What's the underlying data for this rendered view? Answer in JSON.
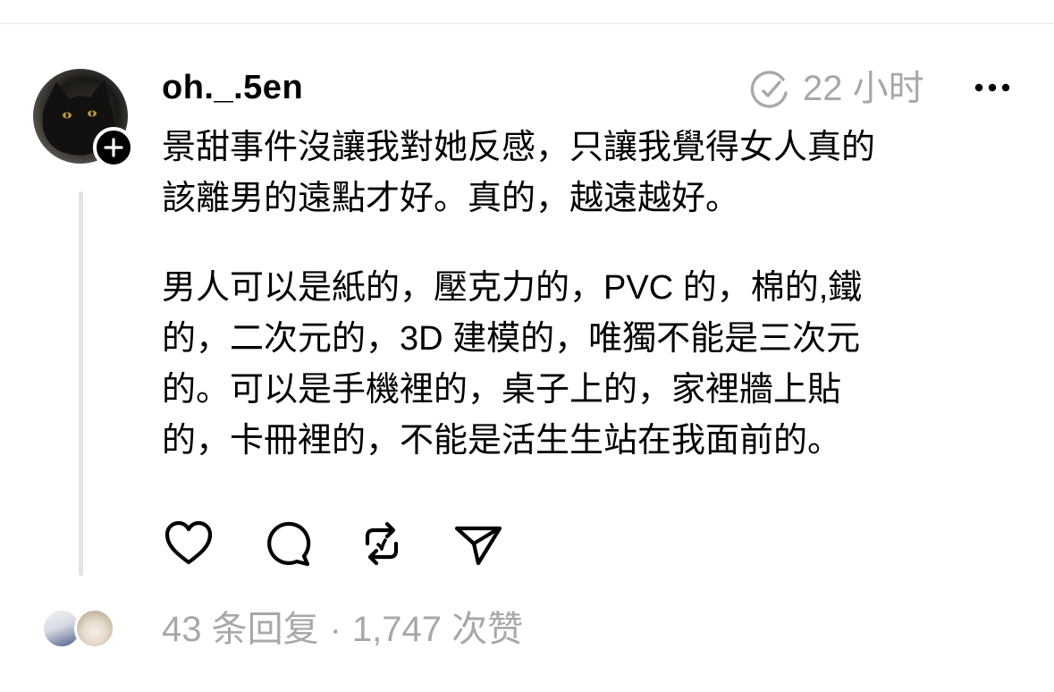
{
  "post": {
    "username": "oh._.5en",
    "time": "22 小时",
    "paragraphs": [
      "景甜事件沒讓我對她反感，只讓我覺得女人真的該離男的遠點才好。真的，越遠越好。",
      "男人可以是紙的，壓克力的，PVC 的，棉的,鐵的，二次元的，3D 建模的，唯獨不能是三次元的。可以是手機裡的，桌子上的，家裡牆上貼的，卡冊裡的，不能是活生生站在我面前的。"
    ],
    "lines_p1": [
      "景甜事件沒讓我對她反感，只讓我覺得女人真的",
      "該離男的遠點才好。真的，越遠越好。"
    ],
    "lines_p2": [
      "男人可以是紙的，壓克力的，PVC 的，棉的,鐵",
      "的，二次元的，3D 建模的，唯獨不能是三次元",
      "的。可以是手機裡的，桌子上的，家裡牆上貼",
      "的，卡冊裡的，不能是活生生站在我面前的。"
    ]
  },
  "stats": {
    "replies": "43 条回复",
    "separator": "·",
    "likes": "1,747 次赞"
  },
  "icons": {
    "edited": "edited-clock-icon",
    "more": "more-icon",
    "like": "heart-icon",
    "comment": "comment-icon",
    "repost": "repost-icon",
    "share": "send-icon",
    "follow": "plus-icon"
  },
  "colors": {
    "text": "#000000",
    "muted": "#a8a8a8",
    "thread_line": "#e3e3e3",
    "background": "#ffffff"
  }
}
